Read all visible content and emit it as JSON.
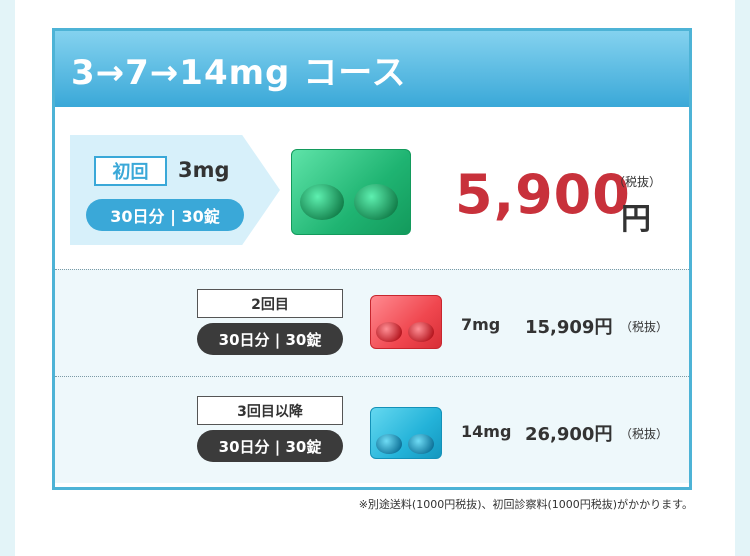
{
  "course": {
    "title": "3→7→14mg コース"
  },
  "first": {
    "label": "初回",
    "dose": "3mg",
    "supply": "30日分 | 30錠",
    "price": "5,900",
    "yen": "円",
    "tax": "（税抜）"
  },
  "second": {
    "label": "2回目",
    "supply": "30日分 | 30錠",
    "dose": "7mg",
    "price": "15,909円",
    "tax": "（税抜）"
  },
  "third": {
    "label": "3回目以降",
    "supply": "30日分 | 30錠",
    "dose": "14mg",
    "price": "26,900円",
    "tax": "（税抜）"
  },
  "footnote": "※別途送料(1000円税抜)、初回診察料(1000円税抜)がかかります。",
  "colors": {
    "accent": "#3aa8d8",
    "price_red": "#c8313b",
    "dark_tag": "#3b3b3b"
  }
}
